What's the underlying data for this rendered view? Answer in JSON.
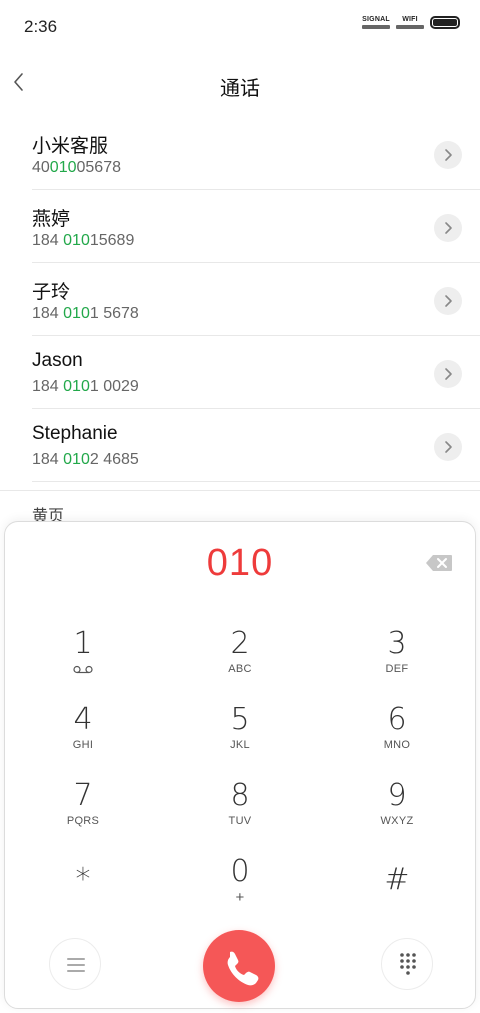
{
  "status_bar": {
    "time": "2:36",
    "signal_label": "SIGNAL",
    "wifi_label": "WIFI"
  },
  "header": {
    "title": "通话"
  },
  "contacts": [
    {
      "name": "小米客服",
      "number_pre": "40",
      "number_hl": "010",
      "number_post": "05678"
    },
    {
      "name": "燕婷",
      "number_pre": "184 ",
      "number_hl": "010",
      "number_post": "15689"
    },
    {
      "name": "子玲",
      "number_pre": "184 ",
      "number_hl": "010",
      "number_post": "1 5678"
    },
    {
      "name": "Jason",
      "number_pre": "184 ",
      "number_hl": "010",
      "number_post": "1 0029"
    },
    {
      "name": "Stephanie",
      "number_pre": "184 ",
      "number_hl": "010",
      "number_post": "2 4685"
    }
  ],
  "section": {
    "label": "黄页"
  },
  "dialer": {
    "dialed_number": "010",
    "keys": [
      {
        "digit": "1",
        "letters": ""
      },
      {
        "digit": "2",
        "letters": "ABC"
      },
      {
        "digit": "3",
        "letters": "DEF"
      },
      {
        "digit": "4",
        "letters": "GHI"
      },
      {
        "digit": "5",
        "letters": "JKL"
      },
      {
        "digit": "6",
        "letters": "MNO"
      },
      {
        "digit": "7",
        "letters": "PQRS"
      },
      {
        "digit": "8",
        "letters": "TUV"
      },
      {
        "digit": "9",
        "letters": "WXYZ"
      },
      {
        "digit": "*",
        "letters": ""
      },
      {
        "digit": "0",
        "letters": "+"
      },
      {
        "digit": "#",
        "letters": ""
      }
    ]
  },
  "colors": {
    "accent_green": "#22a84a",
    "dial_red": "#ee3b3b",
    "call_button": "#f55757"
  }
}
